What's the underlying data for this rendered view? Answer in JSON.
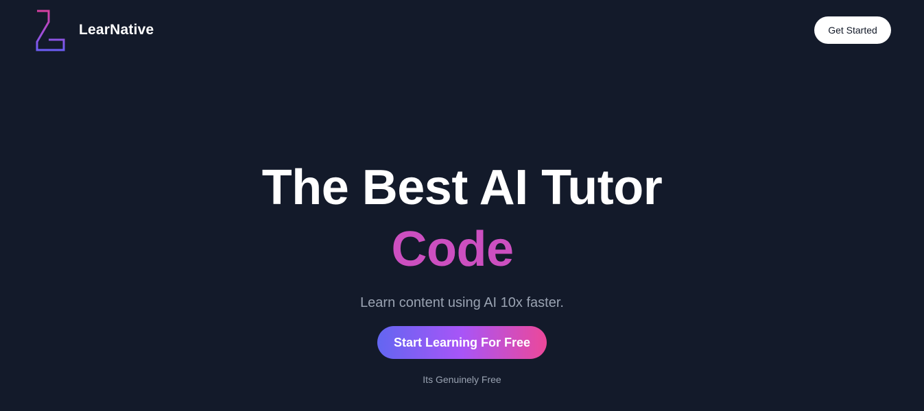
{
  "header": {
    "brand_name": "LearNative",
    "logo_icon": "learnative-logo-icon",
    "cta_label": "Get Started"
  },
  "hero": {
    "headline": "The Best AI Tutor",
    "rotating_word": "Code",
    "subtitle": "Learn content using AI 10x faster.",
    "cta_label": "Start Learning For Free",
    "note": "Its Genuinely Free"
  },
  "colors": {
    "background": "#131a2a",
    "accent_word": "#cc4fc0",
    "gradient_start": "#6366f1",
    "gradient_mid": "#a855f7",
    "gradient_end": "#ec4899",
    "logo_pink": "#d63fa0",
    "logo_purple": "#6d5df5"
  }
}
